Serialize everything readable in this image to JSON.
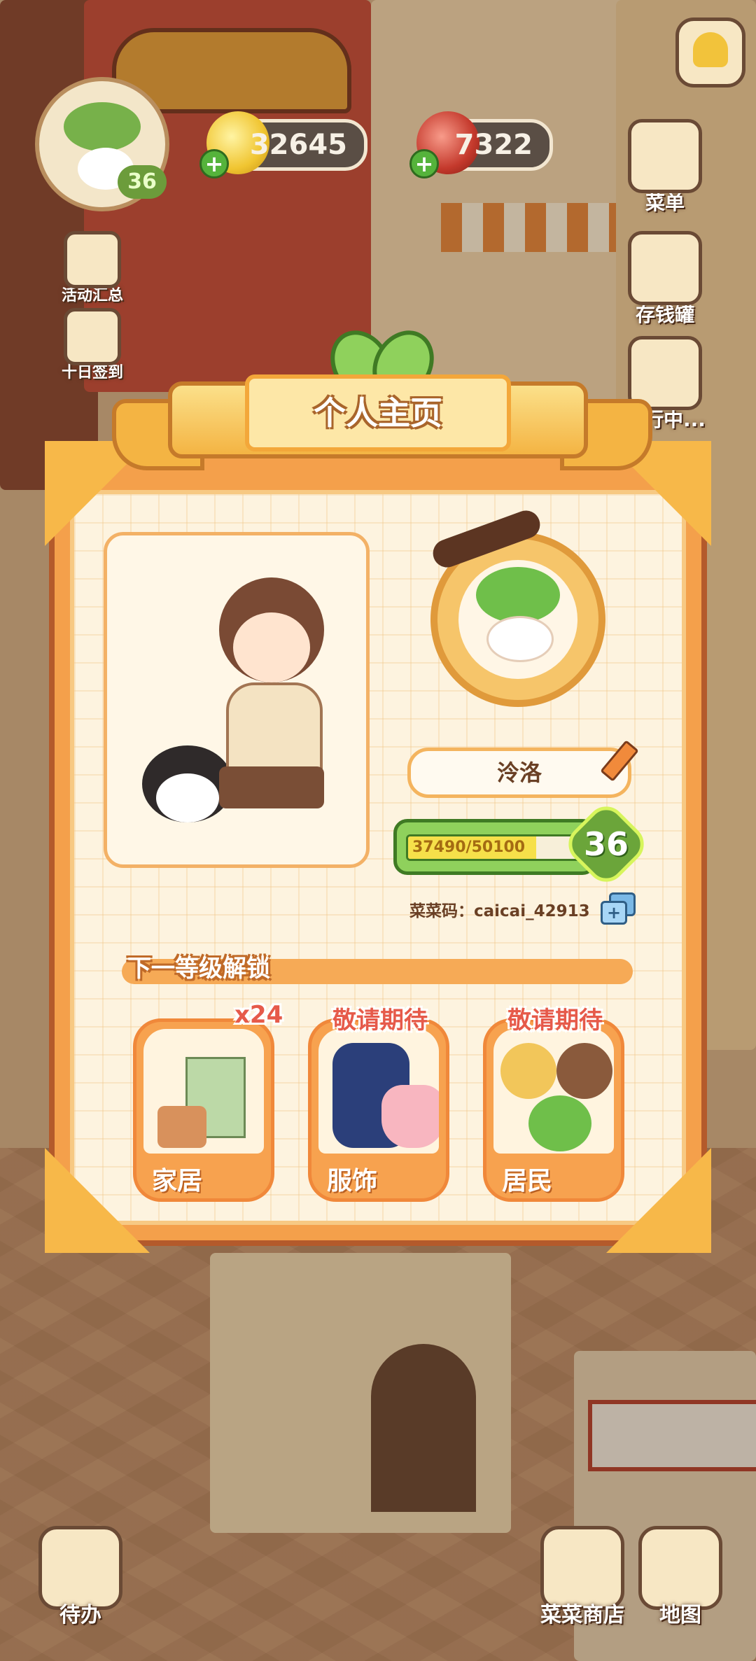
{
  "hud": {
    "player_level": "36",
    "coins": "32645",
    "tomatoes": "7322",
    "right_buttons": [
      {
        "label": "菜单",
        "icon": "menu-icon"
      },
      {
        "label": "存钱罐",
        "icon": "piggy-bank-icon"
      },
      {
        "label": "旅行中...",
        "icon": "camera-icon"
      }
    ],
    "left_buttons": [
      {
        "label": "活动汇总",
        "icon": "events-icon"
      },
      {
        "label": "十日签到",
        "icon": "calendar-icon"
      }
    ],
    "bottom_buttons": [
      {
        "label": "待办",
        "icon": "todo-icon"
      },
      {
        "label": "菜菜商店",
        "icon": "shop-icon"
      },
      {
        "label": "地图",
        "icon": "map-icon"
      }
    ]
  },
  "profile": {
    "title": "个人主页",
    "name": "泠洛",
    "exp_text": "37490/50100",
    "exp_progress": 0.748,
    "level": "36",
    "code_label": "菜菜码：",
    "code_value": "caicai_42913",
    "unlock_title": "下一等级解锁",
    "rewards": [
      {
        "label": "家居",
        "tag": "x24"
      },
      {
        "label": "服饰",
        "tag": "敬请期待"
      },
      {
        "label": "居民",
        "tag": "敬请期待"
      }
    ]
  },
  "colors": {
    "accent_orange": "#f4a04b",
    "frame_brown": "#b45a2b",
    "level_green": "#6ba53a",
    "panel_cream": "#fdf3df"
  }
}
